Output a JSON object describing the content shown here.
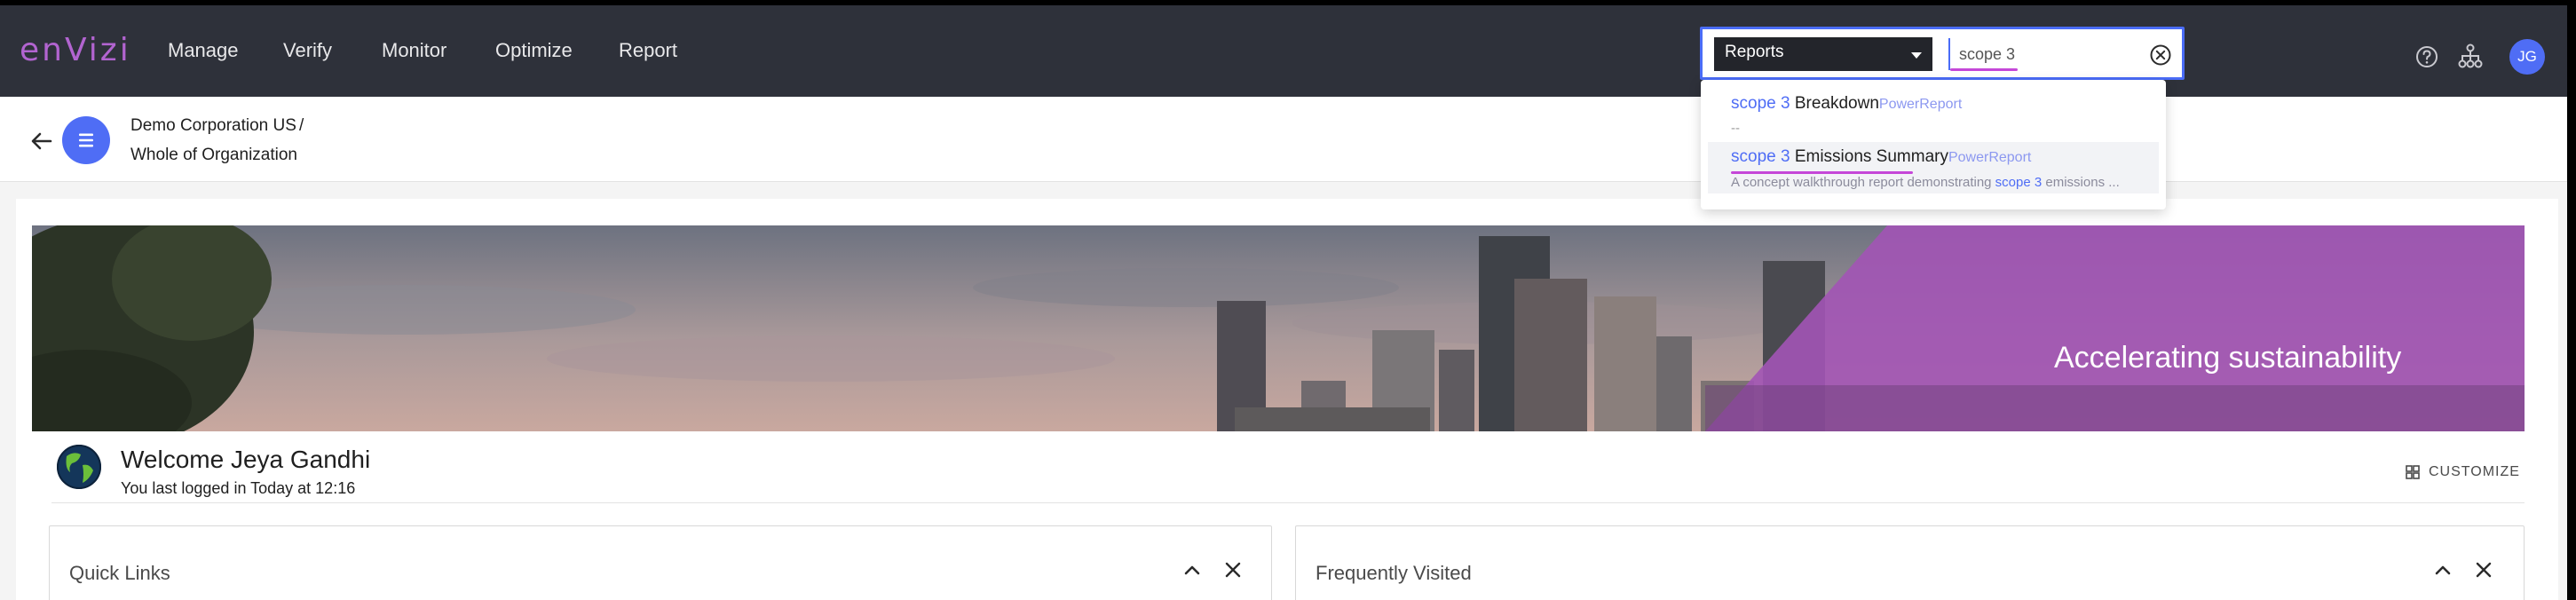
{
  "app": {
    "logo": "enVizi"
  },
  "nav": {
    "items": [
      {
        "label": "Manage"
      },
      {
        "label": "Verify"
      },
      {
        "label": "Monitor"
      },
      {
        "label": "Optimize"
      },
      {
        "label": "Report"
      }
    ]
  },
  "search": {
    "scope": "Reports",
    "value": "scope 3",
    "results": [
      {
        "highlight": "scope 3",
        "title": " Breakdown",
        "type": "PowerReport",
        "sub": "--"
      },
      {
        "highlight": "scope 3",
        "title": " Emissions Summary",
        "type": "PowerReport",
        "desc_before": "A concept walkthrough report demonstrating ",
        "desc_highlight": "scope 3",
        "desc_after": " emissions ..."
      }
    ]
  },
  "header": {
    "user_initials": "JG"
  },
  "breadcrumb": {
    "organization": "Demo Corporation US",
    "separator": "/",
    "location": "Whole of Organization"
  },
  "banner": {
    "tagline": "Accelerating sustainability"
  },
  "welcome": {
    "title": "Welcome Jeya Gandhi",
    "subtitle": "You last logged in Today at 12:16",
    "customize_label": "CUSTOMIZE"
  },
  "panels": [
    {
      "title": "Quick Links"
    },
    {
      "title": "Frequently Visited"
    }
  ],
  "colors": {
    "accent": "#4f6df5",
    "brand": "#b264d0",
    "nav_bg": "#2e313a",
    "highlight_underline": "#c547d8"
  }
}
